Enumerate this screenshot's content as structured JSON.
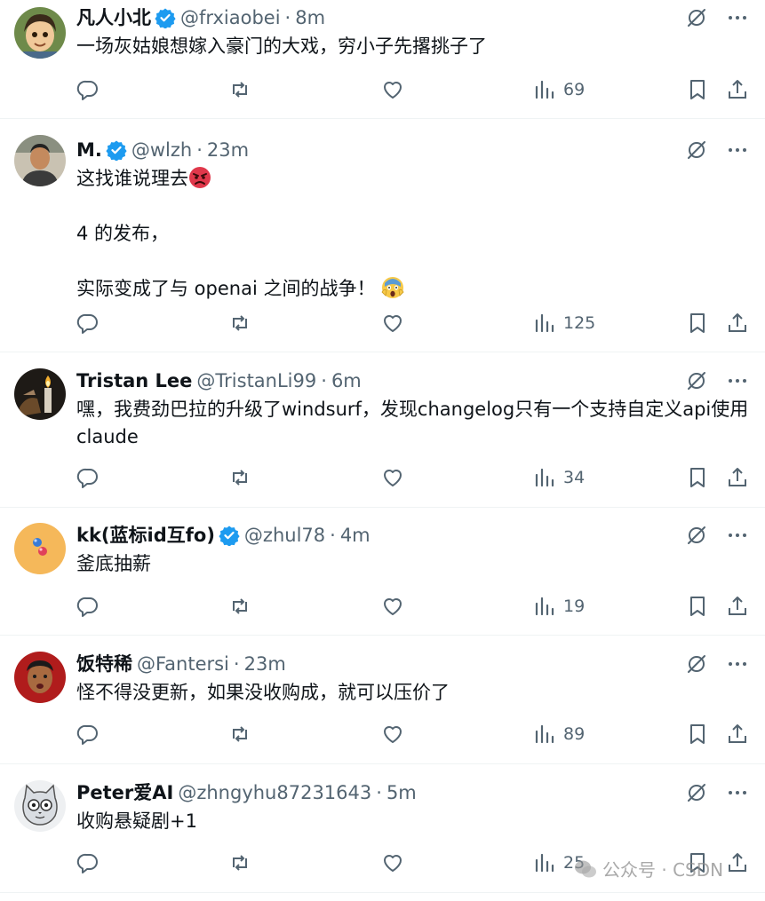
{
  "tweets": [
    {
      "name": "凡人小北",
      "verified": true,
      "handle": "@frxiaobei",
      "sep": "·",
      "time": "8m",
      "lines": [
        "一场灰姑娘想嫁入豪门的大戏，穷小子先撂挑子了"
      ],
      "views": "69",
      "avatar": "cartoon-boy"
    },
    {
      "name": "M.",
      "verified": true,
      "handle": "@wlzh",
      "sep": "·",
      "time": "23m",
      "lines": [
        "这找谁说理去",
        "4 的发布，",
        "实际变成了与 openai 之间的战争！"
      ],
      "views": "125",
      "avatar": "photo-man"
    },
    {
      "name": "Tristan Lee",
      "verified": false,
      "handle": "@TristanLi99",
      "sep": "·",
      "time": "6m",
      "lines": [
        "嘿，我费劲巴拉的升级了windsurf，发现changelog只有一个支持自定义api使用claude"
      ],
      "views": "34",
      "avatar": "candle"
    },
    {
      "name": "kk(蓝标id互fo)",
      "verified": true,
      "handle": "@zhul78",
      "sep": "·",
      "time": "4m",
      "lines": [
        "釜底抽薪"
      ],
      "views": "19",
      "avatar": "orange-dots"
    },
    {
      "name": "饭特稀",
      "verified": false,
      "handle": "@Fantersi",
      "sep": "·",
      "time": "23m",
      "lines": [
        "怪不得没更新，如果没收购成，就可以压价了"
      ],
      "views": "89",
      "avatar": "photo-face"
    },
    {
      "name": "Peter爱AI",
      "verified": false,
      "handle": "@zhngyhu87231643",
      "sep": "·",
      "time": "5m",
      "lines": [
        "收购悬疑剧+1"
      ],
      "views": "25",
      "avatar": "cat"
    }
  ],
  "watermark": {
    "text": "公众号 · CSDN"
  },
  "colors": {
    "text": "#0f1419",
    "secondary": "#536471",
    "verified": "#1d9bf0",
    "divider": "#eff3f4"
  }
}
